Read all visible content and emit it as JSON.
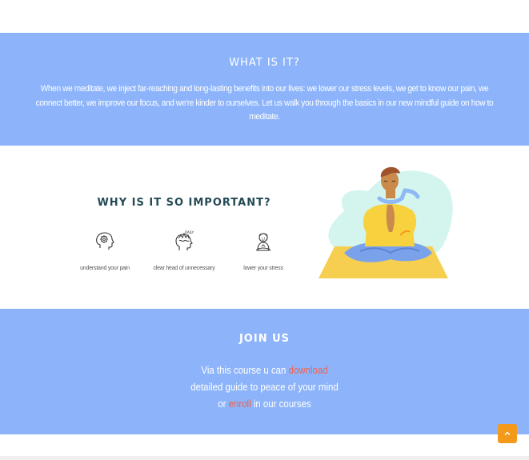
{
  "what": {
    "title": "WHAT IS IT?",
    "text": "When we meditate, we inject far-reaching and long-lasting benefits into our lives: we lower our stress levels, we get to know our pain, we connect better, we improve our focus, and we're kinder to ourselves. Let us walk you through the basics in our new mindful guide on how to meditate."
  },
  "why": {
    "title": "WHY IS IT SO IMPORTANT?",
    "benefits": [
      {
        "icon": "brain-gear-icon",
        "label": "understand your pain"
      },
      {
        "icon": "head-thoughts-icon",
        "label": "clear head of unnecessary"
      },
      {
        "icon": "meditating-person-icon",
        "label": "lower your stress"
      }
    ],
    "illustration": "meditating-man-illustration"
  },
  "join": {
    "title": "JOIN US",
    "line1_prefix": "Via this course u can ",
    "download_link": "download",
    "line2": "detailed guide to peace of your mind",
    "line3_prefix": "or ",
    "enroll_link": "enroll",
    "line3_suffix": " in our courses"
  },
  "scroll_top": {
    "icon": "chevron-up-icon"
  },
  "colors": {
    "section_blue": "#8db4fb",
    "title_dark": "#234a55",
    "link_red": "#f0604c",
    "scroll_orange": "#f39a1b"
  }
}
